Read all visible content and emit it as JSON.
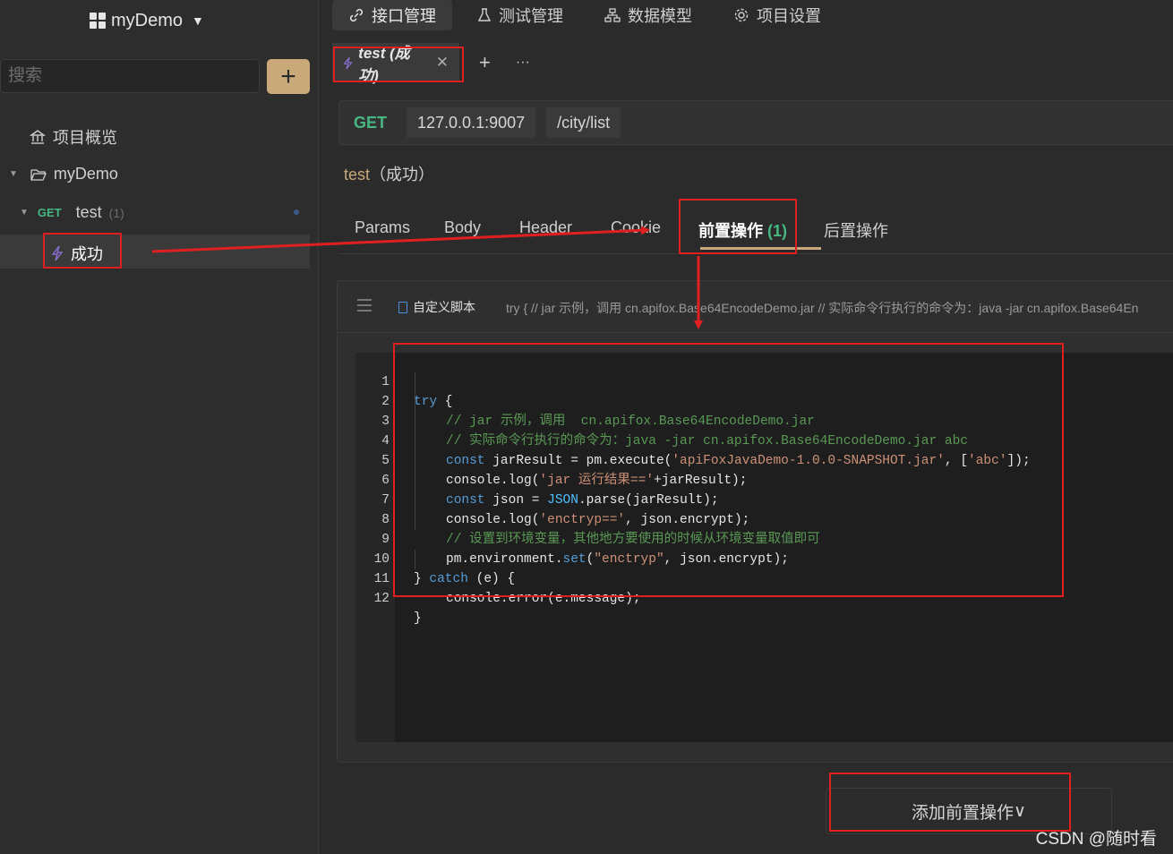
{
  "sidebar": {
    "project_title": "myDemo",
    "search_placeholder": "搜索",
    "overview_label": "项目概览",
    "folder_label": "myDemo",
    "request": {
      "method": "GET",
      "name": "test",
      "count": "(1)"
    },
    "case_label": "成功"
  },
  "top_nav": [
    {
      "label": "接口管理",
      "icon": "link-icon"
    },
    {
      "label": "测试管理",
      "icon": "flask-icon"
    },
    {
      "label": "数据模型",
      "icon": "schema-icon"
    },
    {
      "label": "项目设置",
      "icon": "gear-icon"
    }
  ],
  "request_tab": {
    "label": "test (成功)",
    "icon": "lightning-icon"
  },
  "url_bar": {
    "method": "GET",
    "host": "127.0.0.1:9007",
    "path": "/city/list"
  },
  "request_name": {
    "name": "test",
    "suffix": "（成功）"
  },
  "sub_tabs": [
    {
      "label": "Params"
    },
    {
      "label": "Body"
    },
    {
      "label": "Header"
    },
    {
      "label": "Cookie"
    },
    {
      "label": "前置操作",
      "count": "(1)"
    },
    {
      "label": "后置操作"
    }
  ],
  "script": {
    "label": "自定义脚本",
    "preview": "try { // jar 示例，调用 cn.apifox.Base64EncodeDemo.jar // 实际命令行执行的命令为：java -jar cn.apifox.Base64En"
  },
  "code_lines": [
    "1",
    "2",
    "3",
    "4",
    "5",
    "6",
    "7",
    "8",
    "9",
    "10",
    "11",
    "12"
  ],
  "code": {
    "l1_kw": "try",
    "l1_rest": " {",
    "l2": "// jar 示例，调用  cn.apifox.Base64EncodeDemo.jar",
    "l3": "// 实际命令行执行的命令为：java -jar cn.apifox.Base64EncodeDemo.jar abc",
    "l4_kw": "const",
    "l4_a": " jarResult = pm.execute(",
    "l4_s1": "'apiFoxJavaDemo-1.0.0-SNAPSHOT.jar'",
    "l4_b": ", [",
    "l4_s2": "'abc'",
    "l4_c": "]);",
    "l5_a": "console.log(",
    "l5_s": "'jar 运行结果=='",
    "l5_b": "+jarResult);",
    "l6_kw": "const",
    "l6_a": " json = ",
    "l6_fn": "JSON",
    "l6_b": ".parse(jarResult);",
    "l7_a": "console.log(",
    "l7_s": "'enctryp=='",
    "l7_b": ", json.encrypt);",
    "l8": "// 设置到环境变量，其他地方要使用的时候从环境变量取值即可",
    "l9_a": "pm.environment.",
    "l9_fn": "set",
    "l9_b": "(",
    "l9_s": "\"enctryp\"",
    "l9_c": ", json.encrypt);",
    "l10_a": "} ",
    "l10_kw": "catch",
    "l10_b": " (e) {",
    "l11": "console.error(e.message);",
    "l12": "}"
  },
  "add_pre_button": {
    "label": "添加前置操作",
    "chevron": "∨"
  },
  "watermark": "CSDN @随时看",
  "colors": {
    "accent": "#c9a97a",
    "get": "#48b883",
    "annotation": "#e02020",
    "background": "#2b2b2b"
  }
}
